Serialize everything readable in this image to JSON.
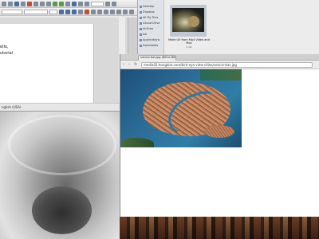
{
  "writer": {
    "page_line1": "ello,",
    "page_line2": "utorial",
    "status_left": "nglish (USA)",
    "status_right": "84%"
  },
  "finder": {
    "sidebar_items": [
      {
        "label": "Desktop"
      },
      {
        "label": "Dropbox"
      },
      {
        "label": "All My Files"
      },
      {
        "label": "iCloud Drive"
      },
      {
        "label": "AirDrop"
      },
      {
        "label": "kai"
      },
      {
        "label": "Applications"
      },
      {
        "label": "Downloads"
      }
    ],
    "file_caption": "Make Gif from Mp4 Video and Mov",
    "file_sub": "4 GB"
  },
  "browser": {
    "tab_title": "venice-bas.jpg (800×480)",
    "url": "media02.hongkiat.com/bird-eye-view-cities/venice-bas.jpg"
  },
  "icons": {
    "back": "‹",
    "forward": "›",
    "refresh": "↻"
  },
  "colors": {
    "finder_sidebar": "#dfe3e8",
    "water": "#2b6d98",
    "rooftops": "#c28662"
  }
}
